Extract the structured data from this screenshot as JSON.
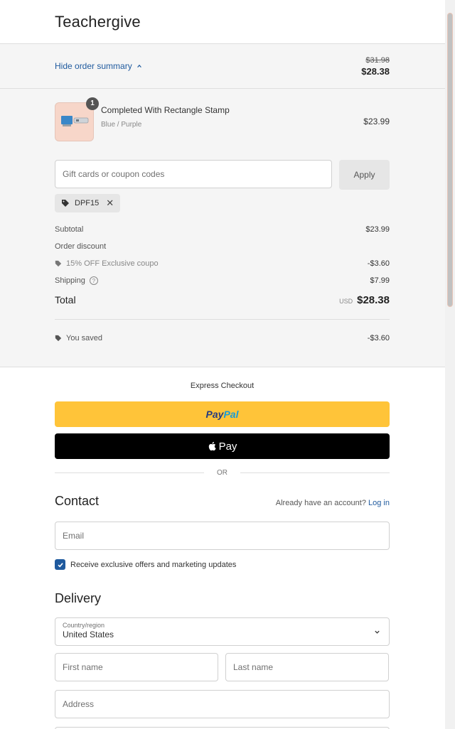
{
  "header": {
    "brand": "Teachergive"
  },
  "summary_bar": {
    "toggle_label": "Hide order summary",
    "old_price": "$31.98",
    "new_price": "$28.38"
  },
  "line_item": {
    "quantity": "1",
    "name": "Completed With Rectangle Stamp",
    "variant": "Blue / Purple",
    "price": "$23.99"
  },
  "coupon": {
    "placeholder": "Gift cards or coupon codes",
    "apply_label": "Apply",
    "applied_code": "DPF15"
  },
  "totals": {
    "subtotal_label": "Subtotal",
    "subtotal_value": "$23.99",
    "discount_label": "Order discount",
    "discount_name": "15% OFF Exclusive coupo",
    "discount_value": "-$3.60",
    "shipping_label": "Shipping",
    "shipping_value": "$7.99",
    "total_label": "Total",
    "currency": "USD",
    "total_value": "$28.38",
    "saved_label": "You saved",
    "saved_value": "-$3.60"
  },
  "express": {
    "title": "Express Checkout",
    "paypal_part1": "Pay",
    "paypal_part2": "Pal",
    "applepay_label": "Pay",
    "or_label": "OR"
  },
  "contact": {
    "title": "Contact",
    "have_account": "Already have an account?",
    "login_link": "Log in",
    "email_placeholder": "Email",
    "marketing_label": "Receive exclusive offers and marketing updates",
    "marketing_checked": true
  },
  "delivery": {
    "title": "Delivery",
    "country_label": "Country/region",
    "country_value": "United States",
    "first_name_placeholder": "First name",
    "last_name_placeholder": "Last name",
    "address_placeholder": "Address"
  },
  "colors": {
    "accent": "#1f5a9e",
    "paypal_yellow": "#ffc439",
    "panel_bg": "#f5f5f5"
  }
}
